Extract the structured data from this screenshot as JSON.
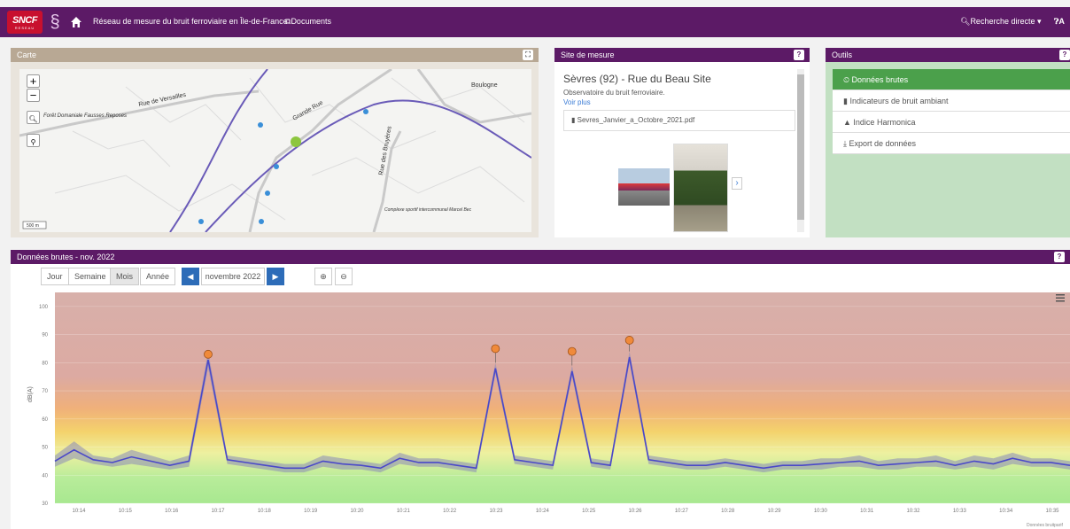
{
  "header": {
    "logo_text": "SNCF",
    "logo_sub": "RESEAU",
    "title": "Réseau de mesure du bruit ferroviaire en Île-de-France",
    "documents": "Documents",
    "search": "Recherche directe",
    "help": "A"
  },
  "map_panel": {
    "title": "Carte",
    "zoom_in": "+",
    "zoom_out": "−",
    "scale": "500 m",
    "labels": [
      "Rue de Versailles",
      "Grande Rue",
      "Rue des Bruyères",
      "Forêt Domaniale Fausses Reposes",
      "Complexe sportif intercommunal Marcel Bec",
      "Boulogne"
    ]
  },
  "site_panel": {
    "title": "Site de mesure",
    "name": "Sèvres (92) - Rue du Beau Site",
    "description": "Observatoire du bruit ferroviaire.",
    "more": "Voir plus",
    "file": "Sevres_Janvier_a_Octobre_2021.pdf"
  },
  "tools_panel": {
    "title": "Outils",
    "items": [
      "Données brutes",
      "Indicateurs de bruit ambiant",
      "Indice Harmonica",
      "Export de données"
    ]
  },
  "chart_panel": {
    "title": "Données brutes - nov. 2022",
    "period_tabs": [
      "Jour",
      "Semaine",
      "Mois",
      "Année"
    ],
    "selected_tab": "Mois",
    "period": "novembre 2022",
    "credit": "Données bruitparif"
  },
  "chart_data": {
    "type": "line",
    "ylabel": "dB(A)",
    "ylim": [
      30,
      105
    ],
    "yticks": [
      30,
      40,
      50,
      60,
      70,
      80,
      90,
      100
    ],
    "x": [
      "10:14",
      "10:15",
      "10:16",
      "10:17",
      "10:18",
      "10:19",
      "10:20",
      "10:21",
      "10:22",
      "10:23",
      "10:24",
      "10:25",
      "10:26",
      "10:27",
      "10:28",
      "10:29",
      "10:30",
      "10:31",
      "10:32",
      "10:33",
      "10:34",
      "10:35"
    ],
    "series": [
      {
        "values": [
          43,
          46,
          44,
          43,
          44,
          43,
          42,
          43,
          78,
          44,
          43,
          42,
          41,
          41,
          43,
          42,
          42,
          41,
          44,
          43,
          43,
          42,
          41,
          76,
          44,
          43,
          42,
          75,
          43,
          42,
          80,
          44,
          43,
          42,
          42,
          43,
          42,
          41,
          42,
          42,
          42,
          43,
          43,
          42,
          42,
          43,
          43,
          42,
          43,
          42,
          44,
          43,
          43,
          42
        ]
      },
      {
        "values": [
          47,
          52,
          47,
          46,
          49,
          47,
          45,
          47,
          84,
          47,
          46,
          45,
          44,
          44,
          47,
          46,
          45,
          44,
          48,
          46,
          46,
          45,
          44,
          80,
          47,
          46,
          45,
          79,
          46,
          45,
          84,
          47,
          46,
          45,
          45,
          46,
          45,
          44,
          45,
          45,
          46,
          46,
          47,
          45,
          46,
          46,
          47,
          45,
          47,
          46,
          48,
          46,
          46,
          45
        ]
      }
    ],
    "peaks": [
      {
        "x": "10:18",
        "y": 83
      },
      {
        "x": "10:22",
        "y": 85
      },
      {
        "x": "10:24",
        "y": 84
      },
      {
        "x": "10:25",
        "y": 88
      }
    ]
  }
}
